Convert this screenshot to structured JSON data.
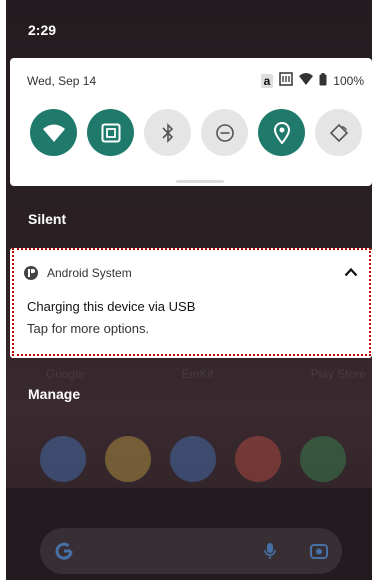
{
  "status_bar": {
    "time": "2:29"
  },
  "quick_settings": {
    "date": "Wed, Sep 14",
    "badge": "a",
    "battery": "100%",
    "tiles": [
      {
        "name": "wifi-tile",
        "icon": "wifi-icon",
        "on": true
      },
      {
        "name": "nfc-tile",
        "icon": "nfc-icon",
        "on": true
      },
      {
        "name": "bluetooth-tile",
        "icon": "bluetooth-icon",
        "on": false
      },
      {
        "name": "dnd-tile",
        "icon": "do-not-disturb-icon",
        "on": false
      },
      {
        "name": "location-tile",
        "icon": "location-icon",
        "on": true
      },
      {
        "name": "auto-rotate-tile",
        "icon": "auto-rotate-icon",
        "on": false
      }
    ],
    "accent_color": "#1f7a6b"
  },
  "section": {
    "silent": "Silent",
    "manage": "Manage"
  },
  "notification": {
    "app": "Android System",
    "title": "Charging this device via USB",
    "text": "Tap for more options."
  },
  "home_ghost": {
    "labels": [
      "Google",
      "EmKit",
      "Play Store"
    ]
  },
  "highlight_color": "#c00000"
}
